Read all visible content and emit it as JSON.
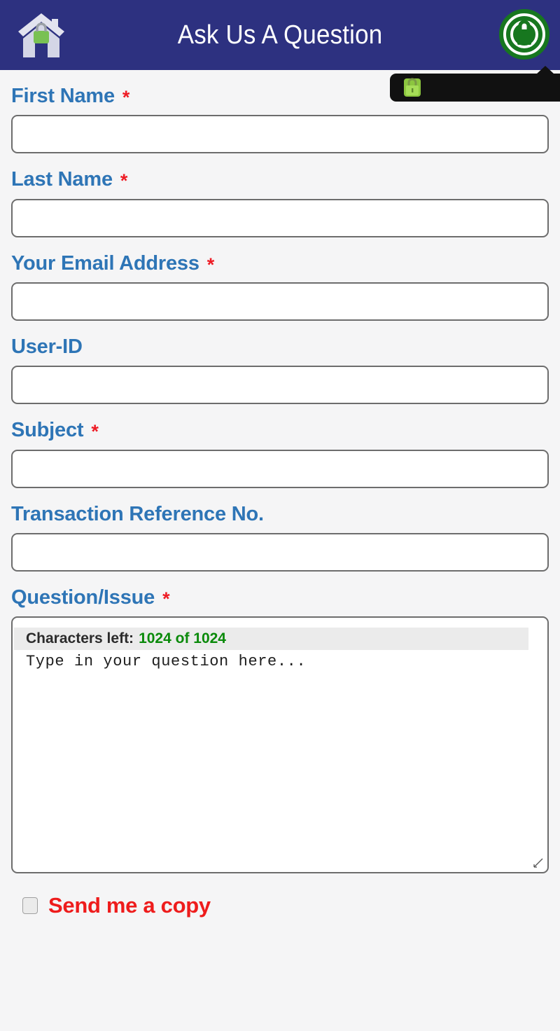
{
  "header": {
    "title": "Ask Us A Question",
    "home_icon": "home-lock-icon",
    "security_icon": "security-lock-badge-icon"
  },
  "tooltip": {
    "icon": "padlock-icon",
    "text": ""
  },
  "form": {
    "fields": [
      {
        "label": "First Name",
        "required": true,
        "required_mark": "*",
        "value": "",
        "placeholder": ""
      },
      {
        "label": "Last Name",
        "required": true,
        "required_mark": "*",
        "value": "",
        "placeholder": ""
      },
      {
        "label": "Your Email Address",
        "required": true,
        "required_mark": "*",
        "value": "",
        "placeholder": ""
      },
      {
        "label": "User-ID",
        "required": false,
        "required_mark": "",
        "value": "",
        "placeholder": ""
      },
      {
        "label": "Subject",
        "required": true,
        "required_mark": "*",
        "value": "",
        "placeholder": ""
      },
      {
        "label": "Transaction Reference No.",
        "required": false,
        "required_mark": "",
        "value": "",
        "placeholder": ""
      }
    ],
    "question": {
      "label": "Question/Issue",
      "required_mark": "*",
      "counter_label": "Characters left:",
      "counter_value": "1024 of 1024",
      "placeholder": "Type in your question here...",
      "value": ""
    },
    "send_copy": {
      "label": "Send me a copy",
      "checked": false
    }
  },
  "colors": {
    "header_bg": "#2d3180",
    "page_bg": "#f5f5f6",
    "label_blue": "#2e75b6",
    "required_red": "#ee1c25",
    "counter_green": "#0a8a0a",
    "copy_red": "#ee1c1c",
    "tooltip_bg": "#111111",
    "input_border": "#6d6d6d"
  }
}
